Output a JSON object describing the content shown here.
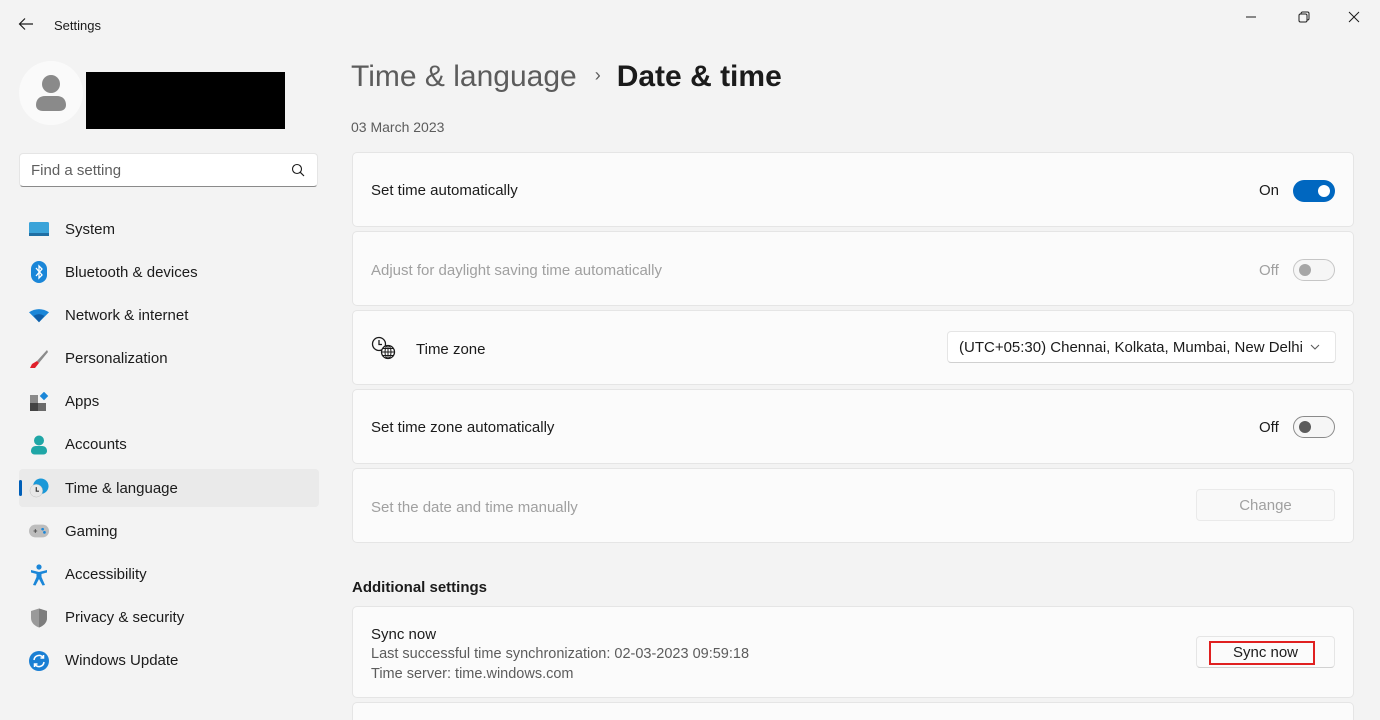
{
  "window": {
    "title": "Settings",
    "controls": {
      "minimize": "minimize-icon",
      "maximize": "restore-icon",
      "close": "close-icon"
    }
  },
  "sidebar": {
    "search_placeholder": "Find a setting",
    "items": [
      {
        "label": "System",
        "icon": "system-icon",
        "active": false
      },
      {
        "label": "Bluetooth & devices",
        "icon": "bluetooth-icon",
        "active": false
      },
      {
        "label": "Network & internet",
        "icon": "wifi-icon",
        "active": false
      },
      {
        "label": "Personalization",
        "icon": "paintbrush-icon",
        "active": false
      },
      {
        "label": "Apps",
        "icon": "apps-icon",
        "active": false
      },
      {
        "label": "Accounts",
        "icon": "accounts-icon",
        "active": false
      },
      {
        "label": "Time & language",
        "icon": "time-language-icon",
        "active": true
      },
      {
        "label": "Gaming",
        "icon": "gamepad-icon",
        "active": false
      },
      {
        "label": "Accessibility",
        "icon": "accessibility-icon",
        "active": false
      },
      {
        "label": "Privacy & security",
        "icon": "shield-icon",
        "active": false
      },
      {
        "label": "Windows Update",
        "icon": "windows-update-icon",
        "active": false
      }
    ]
  },
  "header": {
    "breadcrumb_parent": "Time & language",
    "breadcrumb_separator": "›",
    "page_title": "Date & time",
    "current_date": "03 March 2023"
  },
  "settings": {
    "set_time_auto": {
      "label": "Set time automatically",
      "state": "On",
      "enabled": true
    },
    "daylight_saving": {
      "label": "Adjust for daylight saving time automatically",
      "state": "Off",
      "enabled": false
    },
    "time_zone": {
      "label": "Time zone",
      "value": "(UTC+05:30) Chennai, Kolkata, Mumbai, New Delhi"
    },
    "set_timezone_auto": {
      "label": "Set time zone automatically",
      "state": "Off",
      "enabled": true
    },
    "manual": {
      "label": "Set the date and time manually",
      "button": "Change",
      "enabled": false
    }
  },
  "additional": {
    "title": "Additional settings",
    "sync": {
      "label": "Sync now",
      "last_sync": "Last successful time synchronization: 02-03-2023 09:59:18",
      "server": "Time server: time.windows.com",
      "button": "Sync now",
      "highlight_color": "#e02020"
    }
  },
  "colors": {
    "accent": "#0067c0",
    "background": "#f3f3f3",
    "card": "#fbfbfb"
  }
}
